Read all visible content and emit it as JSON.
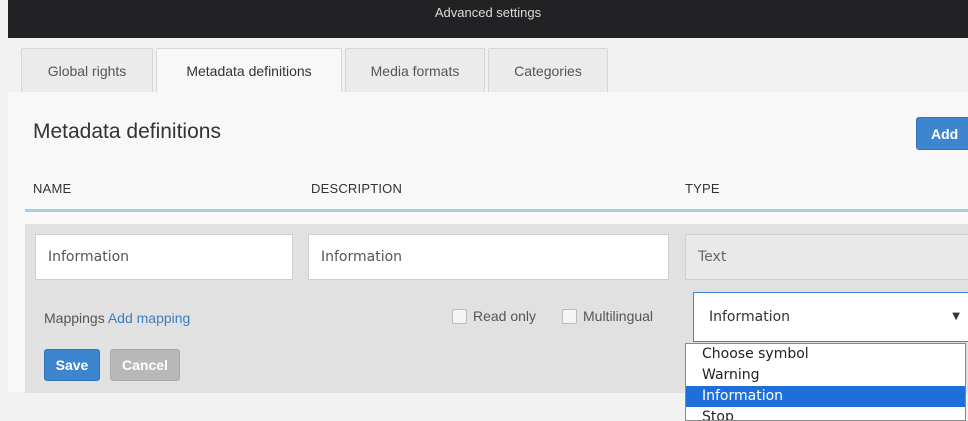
{
  "topbar": {
    "title": "Advanced settings"
  },
  "tabs": [
    {
      "label": "Global rights"
    },
    {
      "label": "Metadata definitions"
    },
    {
      "label": "Media formats"
    },
    {
      "label": "Categories"
    }
  ],
  "page": {
    "title": "Metadata definitions",
    "add_label": "Add"
  },
  "columns": {
    "name": "NAME",
    "description": "DESCRIPTION",
    "type": "TYPE"
  },
  "form": {
    "name_value": "Information",
    "description_value": "Information",
    "type_value": "Text",
    "mappings_label": "Mappings",
    "add_mapping_link": "Add mapping",
    "readonly_label": "Read only",
    "multilingual_label": "Multilingual",
    "symbol_selected": "Information",
    "save_label": "Save",
    "cancel_label": "Cancel"
  },
  "symbol_options": [
    {
      "label": "Choose symbol"
    },
    {
      "label": "Warning"
    },
    {
      "label": "Information"
    },
    {
      "label": "Stop"
    }
  ],
  "colors": {
    "accent": "#3d86cf",
    "topbar": "#222225",
    "selected_option": "#1e6fd9"
  }
}
